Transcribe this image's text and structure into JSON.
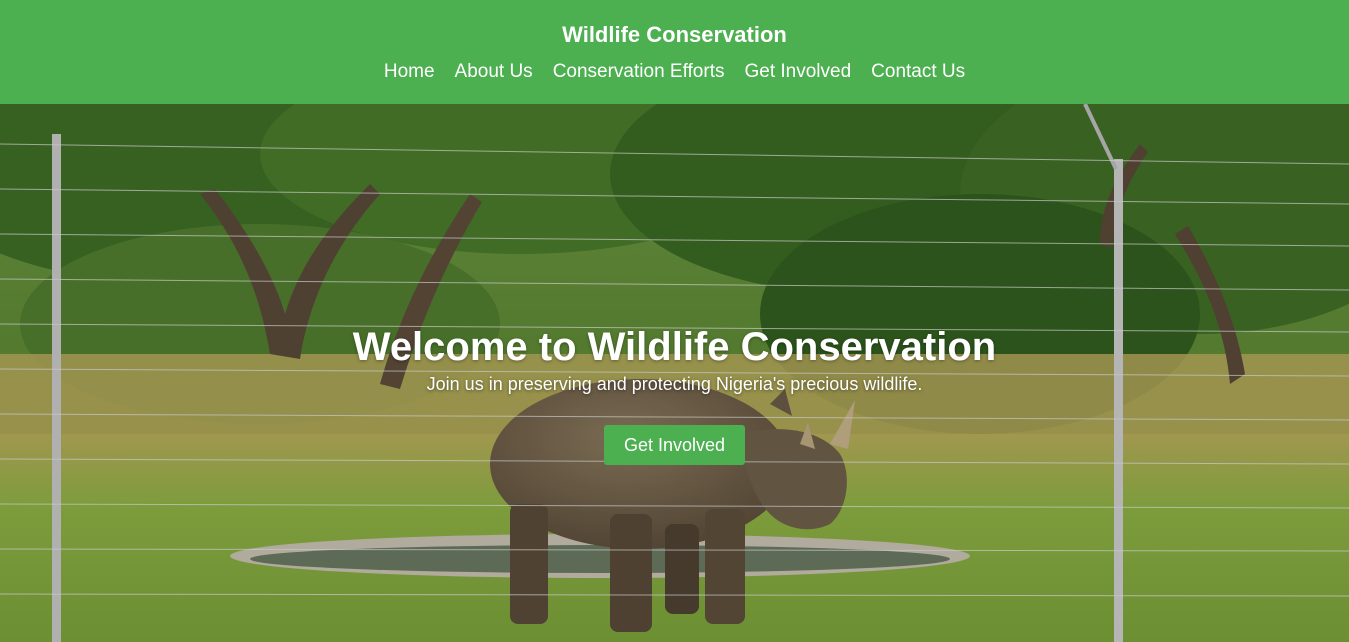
{
  "header": {
    "title": "Wildlife Conservation",
    "nav": [
      "Home",
      "About Us",
      "Conservation Efforts",
      "Get Involved",
      "Contact Us"
    ]
  },
  "hero": {
    "title": "Welcome to Wildlife Conservation",
    "subtitle": "Join us in preserving and protecting Nigeria's precious wildlife.",
    "cta_label": "Get Involved",
    "image_subject": "rhinoceros standing in green savanna behind a wire fence"
  },
  "colors": {
    "brand_green": "#4caf50",
    "text": "#ffffff"
  }
}
